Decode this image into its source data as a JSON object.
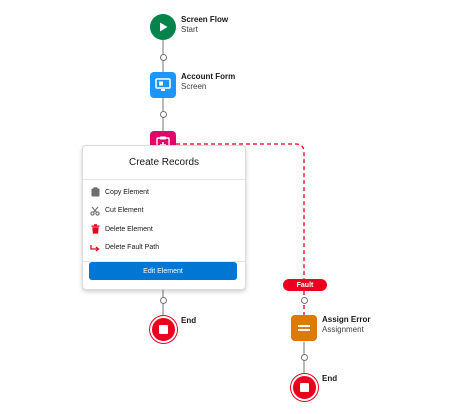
{
  "nodes": {
    "start": {
      "title": "Screen Flow",
      "subtitle": "Start",
      "color": "#04844b"
    },
    "account_form": {
      "title": "Account Form",
      "subtitle": "Screen",
      "color": "#1b96ff"
    },
    "create_records": {
      "color": "#e3066a"
    },
    "end_main": {
      "title": "End",
      "color": "#ea001e"
    },
    "assign_error": {
      "title": "Assign Error",
      "subtitle": "Assignment",
      "color": "#dd7a01"
    },
    "end_fault": {
      "title": "End",
      "color": "#ea001e"
    }
  },
  "menu": {
    "title": "Create Records",
    "items": [
      {
        "label": "Copy Element",
        "icon": "clipboard-icon"
      },
      {
        "label": "Cut Element",
        "icon": "scissors-icon"
      },
      {
        "label": "Delete Element",
        "icon": "trash-icon"
      },
      {
        "label": "Delete Fault Path",
        "icon": "fault-path-icon"
      }
    ],
    "edit_button": "Edit Element"
  },
  "fault": {
    "label": "Fault",
    "color": "#ea001e"
  }
}
